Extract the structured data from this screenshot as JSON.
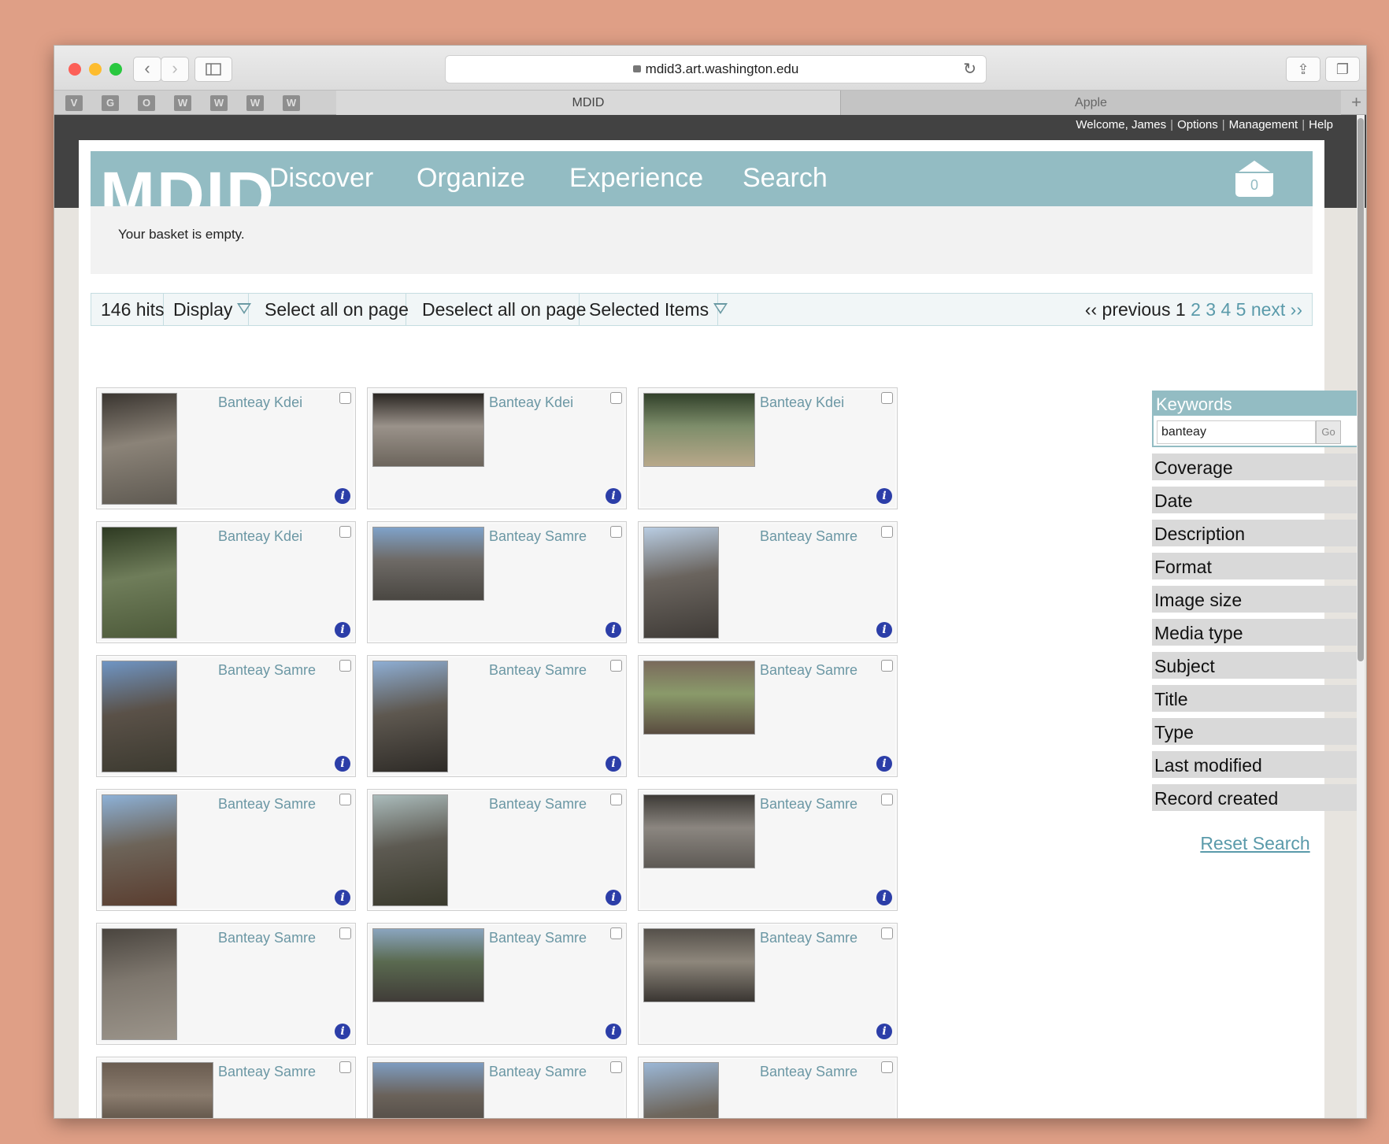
{
  "browser": {
    "url": "mdid3.art.washington.edu",
    "favicons": [
      "V",
      "G",
      "O",
      "W",
      "W",
      "W",
      "W"
    ],
    "tabs": [
      "MDID",
      "Apple"
    ],
    "new_tab": "+"
  },
  "usermenu": [
    "Welcome, James",
    "Options",
    "Management",
    "Help"
  ],
  "header": {
    "logo": "MDID",
    "nav": [
      "Discover",
      "Organize",
      "Experience",
      "Search"
    ],
    "basket_count": "0"
  },
  "basket_message": "Your basket is empty.",
  "toolbar": {
    "hits": "146 hits",
    "display": "Display",
    "select_all": "Select all on page",
    "deselect_all": "Deselect all on page",
    "selected_items": "Selected Items"
  },
  "pager": {
    "previous": "‹‹ previous",
    "current": "1",
    "pages": [
      "2",
      "3",
      "4",
      "5"
    ],
    "next": "next ››"
  },
  "results": [
    {
      "title": "Banteay Kdei",
      "colors": [
        "#3a3530",
        "#8b8378",
        "#5f5a52"
      ],
      "orientation": "portrait"
    },
    {
      "title": "Banteay Kdei",
      "colors": [
        "#2a2622",
        "#9a928a",
        "#6c655c"
      ],
      "orientation": "landscape"
    },
    {
      "title": "Banteay Kdei",
      "colors": [
        "#31402a",
        "#7d8d6a",
        "#b8a88a"
      ],
      "orientation": "landscape"
    },
    {
      "title": "Banteay Kdei",
      "colors": [
        "#2e3a22",
        "#6f7d5a",
        "#4d5a3a"
      ],
      "orientation": "portrait"
    },
    {
      "title": "Banteay Samre",
      "colors": [
        "#7fa2c9",
        "#6e6a66",
        "#4a4742"
      ],
      "orientation": "landscape"
    },
    {
      "title": "Banteay Samre",
      "colors": [
        "#b9cde3",
        "#6a645e",
        "#3f3b37"
      ],
      "orientation": "portrait"
    },
    {
      "title": "Banteay Samre",
      "colors": [
        "#6f95c4",
        "#5a5148",
        "#3c3a30"
      ],
      "orientation": "portrait"
    },
    {
      "title": "Banteay Samre",
      "colors": [
        "#8eaed4",
        "#5e5850",
        "#2e2b27"
      ],
      "orientation": "portrait"
    },
    {
      "title": "Banteay Samre",
      "colors": [
        "#7a6a5c",
        "#8a9a6a",
        "#5a4c40"
      ],
      "orientation": "landscape"
    },
    {
      "title": "Banteay Samre",
      "colors": [
        "#8db1d7",
        "#6d6459",
        "#5a3d2f"
      ],
      "orientation": "portrait"
    },
    {
      "title": "Banteay Samre",
      "colors": [
        "#aabbbb",
        "#5d5a52",
        "#3a3a2d"
      ],
      "orientation": "portrait"
    },
    {
      "title": "Banteay Samre",
      "colors": [
        "#3d3a36",
        "#8b8680",
        "#5e5a55"
      ],
      "orientation": "landscape"
    },
    {
      "title": "Banteay Samre",
      "colors": [
        "#4a453f",
        "#7e776e",
        "#9b948a"
      ],
      "orientation": "portrait"
    },
    {
      "title": "Banteay Samre",
      "colors": [
        "#8aa5be",
        "#5a6a50",
        "#403c38"
      ],
      "orientation": "landscape"
    },
    {
      "title": "Banteay Samre",
      "colors": [
        "#55504a",
        "#8e877c",
        "#3a3632"
      ],
      "orientation": "landscape"
    },
    {
      "title": "Banteay Samre",
      "colors": [
        "#6a5c50",
        "#8a7c6e",
        "#4a3e34"
      ],
      "orientation": "landscape"
    },
    {
      "title": "Banteay Samre",
      "colors": [
        "#7e9cc0",
        "#6a625a",
        "#4a443e"
      ],
      "orientation": "landscape"
    },
    {
      "title": "Banteay Samre",
      "colors": [
        "#9bb7d6",
        "#6e665c",
        "#524a42"
      ],
      "orientation": "portrait"
    }
  ],
  "sidebar": {
    "keywords_label": "Keywords",
    "keywords_value": "banteay",
    "go_label": "Go",
    "facets": [
      "Coverage",
      "Date",
      "Description",
      "Format",
      "Image size",
      "Media type",
      "Subject",
      "Title",
      "Type",
      "Last modified",
      "Record created"
    ],
    "reset": "Reset Search"
  },
  "colors": {
    "accent": "#93bcc3",
    "link": "#5a9aaa",
    "info": "#2c3ea8"
  }
}
